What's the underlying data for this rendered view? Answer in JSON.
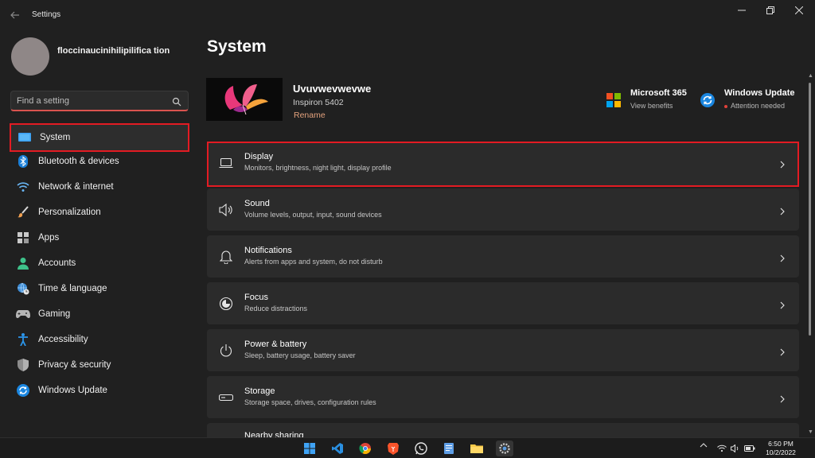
{
  "window": {
    "title": "Settings"
  },
  "sidebar": {
    "user_name": "floccinaucinihilipilifica tion",
    "search_placeholder": "Find a setting",
    "items": [
      {
        "label": "System",
        "icon": "monitor-icon",
        "selected": true
      },
      {
        "label": "Bluetooth & devices",
        "icon": "bluetooth-icon"
      },
      {
        "label": "Network & internet",
        "icon": "wifi-icon"
      },
      {
        "label": "Personalization",
        "icon": "paintbrush-icon"
      },
      {
        "label": "Apps",
        "icon": "apps-grid-icon"
      },
      {
        "label": "Accounts",
        "icon": "person-icon"
      },
      {
        "label": "Time & language",
        "icon": "globe-clock-icon"
      },
      {
        "label": "Gaming",
        "icon": "gamepad-icon"
      },
      {
        "label": "Accessibility",
        "icon": "accessibility-icon"
      },
      {
        "label": "Privacy & security",
        "icon": "shield-icon"
      },
      {
        "label": "Windows Update",
        "icon": "windows-update-icon"
      }
    ]
  },
  "main": {
    "title": "System",
    "device": {
      "name": "Uvuvwevwevwe",
      "model": "Inspiron 5402",
      "rename_label": "Rename"
    },
    "promos": [
      {
        "title": "Microsoft 365",
        "subtitle": "View benefits",
        "icon": "microsoft-logo-icon"
      },
      {
        "title": "Windows Update",
        "subtitle": "Attention needed",
        "icon": "windows-update-icon"
      }
    ],
    "cards": [
      {
        "title": "Display",
        "subtitle": "Monitors, brightness, night light, display profile",
        "icon": "laptop-icon",
        "selected": true
      },
      {
        "title": "Sound",
        "subtitle": "Volume levels, output, input, sound devices",
        "icon": "speaker-icon"
      },
      {
        "title": "Notifications",
        "subtitle": "Alerts from apps and system, do not disturb",
        "icon": "bell-icon"
      },
      {
        "title": "Focus",
        "subtitle": "Reduce distractions",
        "icon": "focus-icon"
      },
      {
        "title": "Power & battery",
        "subtitle": "Sleep, battery usage, battery saver",
        "icon": "power-icon"
      },
      {
        "title": "Storage",
        "subtitle": "Storage space, drives, configuration rules",
        "icon": "storage-icon"
      },
      {
        "title": "Nearby sharing",
        "subtitle": "",
        "icon": "share-icon"
      }
    ]
  },
  "taskbar": {
    "apps": [
      "windows-start-icon",
      "vscode-icon",
      "chrome-icon",
      "brave-icon",
      "whatsapp-icon",
      "notepad-icon",
      "file-explorer-icon",
      "settings-icon"
    ],
    "time": "6:50 PM",
    "date": "10/2/2022"
  },
  "colors": {
    "background": "#202020",
    "card": "#2b2b2b",
    "highlight_outline": "#e31b23",
    "accent_link": "#e3a27d",
    "system_blue": "#3aa0f3"
  }
}
